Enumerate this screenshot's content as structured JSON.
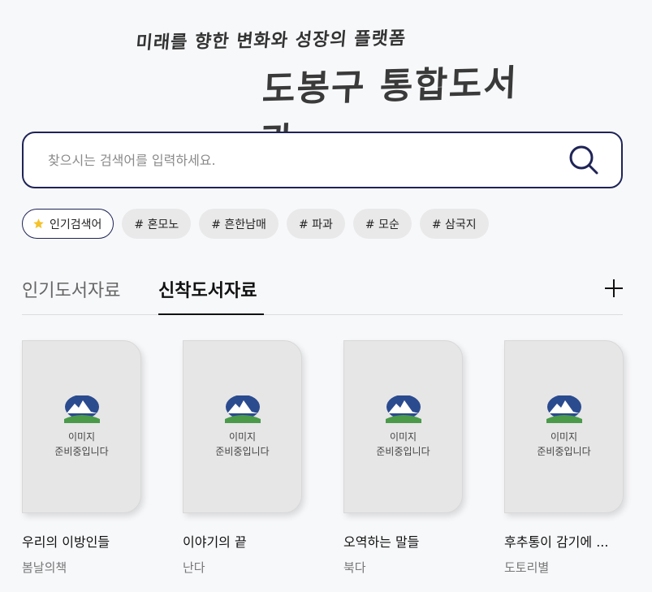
{
  "brand": {
    "tagline": "미래를 향한 변화와 성장의 플랫폼",
    "title": "도봉구 통합도서관"
  },
  "search": {
    "placeholder": "찾으시는 검색어를 입력하세요."
  },
  "keywords": {
    "label": "인기검색어",
    "items": [
      "# 혼모노",
      "# 흔한남매",
      "# 파과",
      "# 모순",
      "# 삼국지"
    ]
  },
  "tabs": {
    "popular": "인기도서자료",
    "new": "신착도서자료",
    "active": "new"
  },
  "books": [
    {
      "cover_line1": "이미지",
      "cover_line2": "준비중입니다",
      "title": "우리의 이방인들",
      "publisher": "봄날의책"
    },
    {
      "cover_line1": "이미지",
      "cover_line2": "준비중입니다",
      "title": "이야기의 끝",
      "publisher": "난다"
    },
    {
      "cover_line1": "이미지",
      "cover_line2": "준비중입니다",
      "title": "오역하는 말들",
      "publisher": "북다"
    },
    {
      "cover_line1": "이미지",
      "cover_line2": "준비중입니다",
      "title": "후추통이 감기에 ...",
      "publisher": "도토리별"
    }
  ],
  "colors": {
    "accent": "#1f2456",
    "star": "#f4c22b",
    "logo_blue": "#2b4b8f",
    "logo_green": "#4a9a4a"
  }
}
